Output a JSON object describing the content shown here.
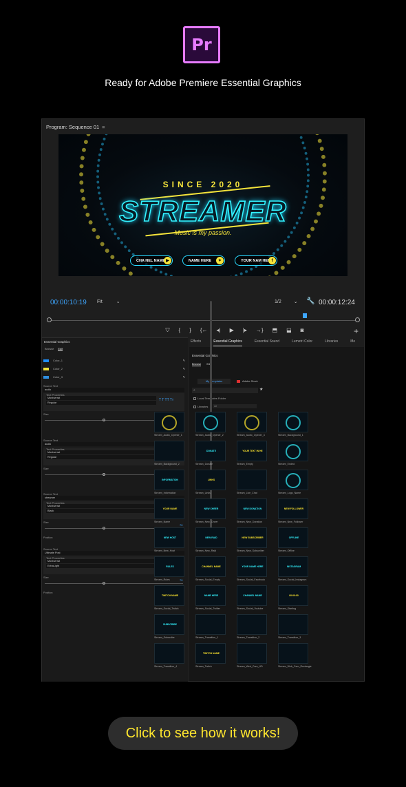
{
  "branding": {
    "logo_text": "Pr",
    "tagline": "Ready for Adobe Premiere Essential Graphics"
  },
  "program_monitor": {
    "title": "Program: Sequence 01",
    "menu_icon": "hamburger-icon",
    "video": {
      "since": "SINCE 2020",
      "title": "STREAMER",
      "subtitle": "Music is my passion.",
      "social": [
        {
          "label": "CHA NEL NAME",
          "icon": "youtube-icon",
          "glyph": "▶"
        },
        {
          "label": "NAME HERE",
          "icon": "twitter-icon",
          "glyph": "✦"
        },
        {
          "label": "YOUR NAM HERE",
          "icon": "facebook-icon",
          "glyph": "f"
        }
      ]
    },
    "timecode_left": "00:00:10:19",
    "fit": "Fit",
    "resolution": "1/2",
    "timecode_right": "00:00:12:24",
    "transport": [
      "⛉",
      "{",
      "}",
      "{←",
      "◂|",
      "▶",
      "|▸",
      "→}",
      "⬒",
      "⬓",
      "◙"
    ],
    "add_button": "+"
  },
  "left_panel": {
    "title": "Essential Graphics",
    "tabs": [
      "Browse",
      "Edit"
    ],
    "colors": [
      {
        "name": "Color_1",
        "hex": "#1f8fff"
      },
      {
        "name": "Color_2",
        "hex": "#f5e43b"
      },
      {
        "name": "Color_3",
        "hex": "#2f8fe0"
      }
    ],
    "sections": [
      {
        "label": "Source Text",
        "text": "audio",
        "font": "Montserrat",
        "style": "Regular",
        "size_label": "Size",
        "value": "70",
        "position_label": ""
      },
      {
        "label": "Source Text",
        "text": "audio",
        "font": "Montserrat",
        "style": "Regular",
        "size_label": "Size",
        "value": "76",
        "position_label": ""
      },
      {
        "label": "Source Text",
        "text": "streamer",
        "font": "Montserrat",
        "style": "Black",
        "size_label": "Size",
        "value": "70",
        "position_label": "Position"
      },
      {
        "label": "Source Text",
        "text": "Ultimate Post",
        "font": "Montserrat",
        "style": "ExtraLight",
        "size_label": "Size",
        "value": "70",
        "position_label": "Position"
      }
    ],
    "text_properties": "Text Properties",
    "position_vals": "960.0   540.0"
  },
  "right_tabs": [
    "Effects",
    "Essential Graphics",
    "Essential Sound",
    "Lumetri Color",
    "Libraries",
    "Me"
  ],
  "right_panel": {
    "title": "Essential Graphics",
    "subtabs": [
      "Browse",
      "Edit"
    ],
    "my_templates": "My Templates",
    "adobe_stock": "Adobe Stock",
    "search_icon": "search-icon",
    "local_templates": "Local Templates Folder",
    "libraries": "Libraries",
    "library_select": "All",
    "templates": [
      "Stream_Audio_Opener_1",
      "Stream_Audio_Opener_2",
      "Stream_Audio_Opener_3",
      "Stream_Background_1",
      "Stream_Background_2",
      "Stream_Donate",
      "Stream_Empty",
      "Stream_Ended",
      "Stream_Information",
      "Stream_Links",
      "Stream_Live_Chat",
      "Stream_Logo_Name",
      "Stream_Name",
      "Stream_New_Cheer",
      "Stream_New_Donation",
      "Stream_New_Follower",
      "Stream_New_Host",
      "Stream_New_Raid",
      "Stream_New_Subscriber",
      "Stream_Offline",
      "Stream_Rules",
      "Stream_Social_Empty",
      "Stream_Social_Facebook",
      "Stream_Social_Instagram",
      "Stream_Social_Twitch",
      "Stream_Social_Twitter",
      "Stream_Social_Youtube",
      "Stream_Starting",
      "Stream_Subscribe",
      "Stream_Transition_1",
      "Stream_Transition_2",
      "Stream_Transition_3",
      "Stream_Transition_4",
      "Stream_Twitch",
      "Stream_Web_Cam_HD",
      "Stream_Web_Cam_Rectangle"
    ],
    "thumb_texts": [
      "",
      "",
      "",
      "",
      "",
      "DONATE",
      "YOUR TEXT IN HE",
      "",
      "INFORMATION",
      "LINKS",
      "",
      "",
      "YOUR NAME",
      "NEW CHEER",
      "NEW DONATION",
      "NEW FOLLOWER",
      "NEW HOST",
      "NEW RAID",
      "NEW SUBSCRIBER",
      "OFFLINE",
      "RULES",
      "CHANNEL NAME",
      "YOUR NAME HERE",
      "INSTAGRAM",
      "TWITCH NAME",
      "NAME HERE",
      "CHANNEL NAME",
      "00:00:00",
      "SUBSCRIBE",
      "",
      "",
      "",
      "",
      "TWITCH NAME",
      "",
      ""
    ]
  },
  "cta": {
    "label": "Click to see how it works!"
  },
  "colors": {
    "accent": "#ffe62e",
    "cyan": "#33f3ff",
    "blue": "#3ea6ff",
    "premiere": "#e77bff"
  }
}
